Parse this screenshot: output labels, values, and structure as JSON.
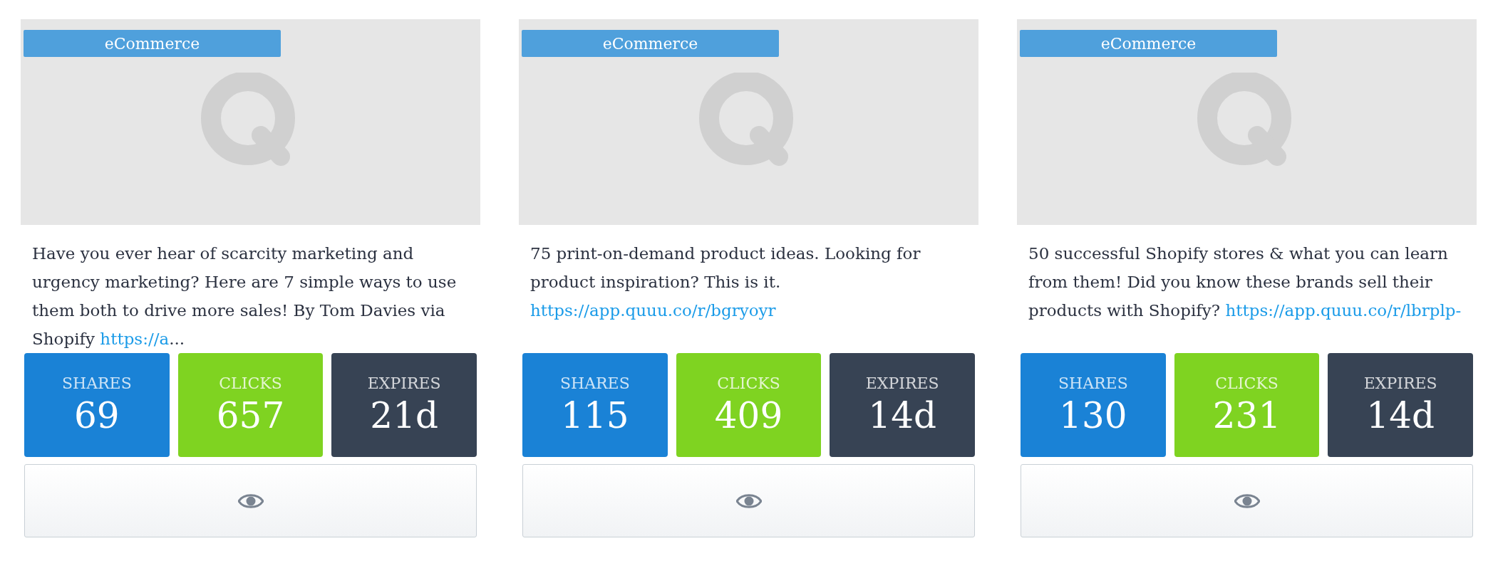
{
  "cards": [
    {
      "tag": "eCommerce",
      "text": "Have you ever hear of scarcity marketing and urgency marketing? Here are 7 simple ways to use them both to drive more sales! By Tom Davies via Shopify ",
      "link": "https://a",
      "tail": "...",
      "stats": [
        {
          "kind": "shares",
          "label": "SHARES",
          "value": "69"
        },
        {
          "kind": "clicks",
          "label": "CLICKS",
          "value": "657"
        },
        {
          "kind": "expires",
          "label": "EXPIRES",
          "value": "21d"
        }
      ]
    },
    {
      "tag": "eCommerce",
      "text": "75 print-on-demand product ideas. Looking for product inspiration? This is it. ",
      "link": "https://app.quuu.co/r/bgryoyr",
      "stats": [
        {
          "kind": "shares",
          "label": "SHARES",
          "value": "115"
        },
        {
          "kind": "clicks",
          "label": "CLICKS",
          "value": "409"
        },
        {
          "kind": "expires",
          "label": "EXPIRES",
          "value": "14d"
        }
      ]
    },
    {
      "tag": "eCommerce",
      "text": "50 successful Shopify stores & what you can learn from them! Did you know these brands sell their products with Shopify? ",
      "link": "https://app.quuu.co/r/lbrplp-",
      "stats": [
        {
          "kind": "shares",
          "label": "SHARES",
          "value": "130"
        },
        {
          "kind": "clicks",
          "label": "CLICKS",
          "value": "231"
        },
        {
          "kind": "expires",
          "label": "EXPIRES",
          "value": "14d"
        }
      ]
    }
  ]
}
